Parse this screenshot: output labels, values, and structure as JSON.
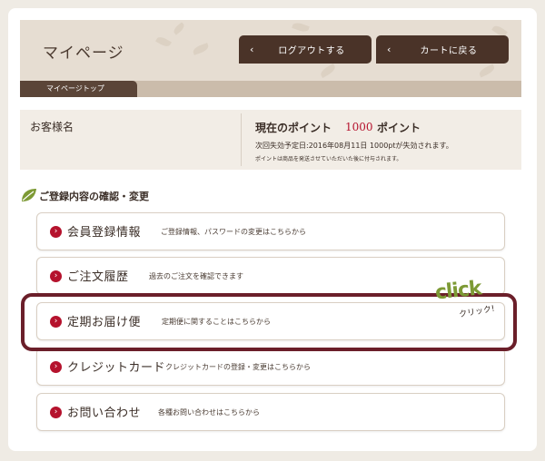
{
  "header": {
    "title": "マイページ",
    "logout_label": "ログアウトする",
    "cart_label": "カートに戻る",
    "subtab_label": "マイページトップ"
  },
  "info": {
    "customer_label": "お客様名",
    "points_label": "現在のポイント",
    "points_value": "1000",
    "points_unit": "ポイント",
    "expire_text": "次回失効予定日:2016年08月11日 1000ptが失効されます。",
    "note_text": "ポイントは商品を発送させていただいた後に付与されます。"
  },
  "section": {
    "title": "ご登録内容の確認・変更"
  },
  "menu": [
    {
      "title": "会員登録情報",
      "desc": "ご登録情報、パスワードの変更はこちらから"
    },
    {
      "title": "ご注文履歴",
      "desc": "過去のご注文を確認できます"
    },
    {
      "title": "定期お届け便",
      "desc": "定期便に関することはこちらから"
    },
    {
      "title": "クレジットカード",
      "desc": "クレジットカードの登録・変更はこちらから"
    },
    {
      "title": "お問い合わせ",
      "desc": "各種お問い合わせはこちらから"
    }
  ],
  "annotation": {
    "click_text": "click",
    "click_kana": "クリック!"
  },
  "colors": {
    "accent": "#b5122d",
    "button_bg": "#4a3328",
    "highlight": "#6b1f2a",
    "click_green": "#7d9a35"
  },
  "icons": {
    "chevron": "chevron-left-icon",
    "bullet": "chevron-right-circle-icon",
    "section": "leaf-icon"
  }
}
